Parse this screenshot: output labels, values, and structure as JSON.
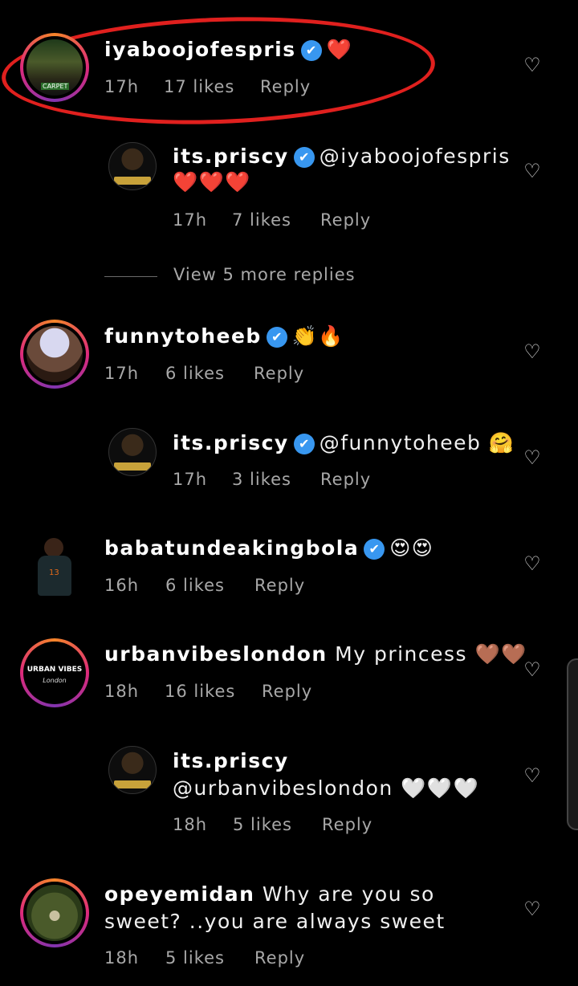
{
  "comments": [
    {
      "username": "iyaboojofespris",
      "verified": true,
      "text": "❤️",
      "time": "17h",
      "likes": "17 likes",
      "reply": "Reply"
    },
    {
      "username": "its.priscy",
      "verified": true,
      "text": "@iyaboojofespris",
      "text2": "❤️❤️❤️",
      "time": "17h",
      "likes": "7 likes",
      "reply": "Reply"
    },
    {
      "username": "funnytoheeb",
      "verified": true,
      "text": "👏🔥",
      "time": "17h",
      "likes": "6 likes",
      "reply": "Reply"
    },
    {
      "username": "its.priscy",
      "verified": true,
      "text": "@funnytoheeb 🤗",
      "time": "17h",
      "likes": "3 likes",
      "reply": "Reply"
    },
    {
      "username": "babatundeakingbola",
      "verified": true,
      "text": "😍😍",
      "time": "16h",
      "likes": "6 likes",
      "reply": "Reply"
    },
    {
      "username": "urbanvibeslondon",
      "verified": false,
      "text": "My princess 🤎🤎",
      "time": "18h",
      "likes": "16 likes",
      "reply": "Reply"
    },
    {
      "username": "its.priscy",
      "verified": false,
      "text": "",
      "text2": "@urbanvibeslondon 🤍🤍🤍",
      "time": "18h",
      "likes": "5 likes",
      "reply": "Reply"
    },
    {
      "username": "opeyemidan",
      "verified": false,
      "text": "Why are you so",
      "text2": "sweet? ..you are always sweet",
      "time": "18h",
      "likes": "5 likes",
      "reply": "Reply"
    }
  ],
  "view_more": "View 5 more replies",
  "avatar_text": {
    "urban": "URBAN VIBES",
    "urban_sub": "London",
    "carpet": "CARPET"
  },
  "icons": {
    "verified": "✔",
    "heart": "♡"
  },
  "colors": {
    "background": "#000000",
    "verified": "#3897f0",
    "highlight": "#e0201e",
    "meta": "#a8a8a8"
  }
}
